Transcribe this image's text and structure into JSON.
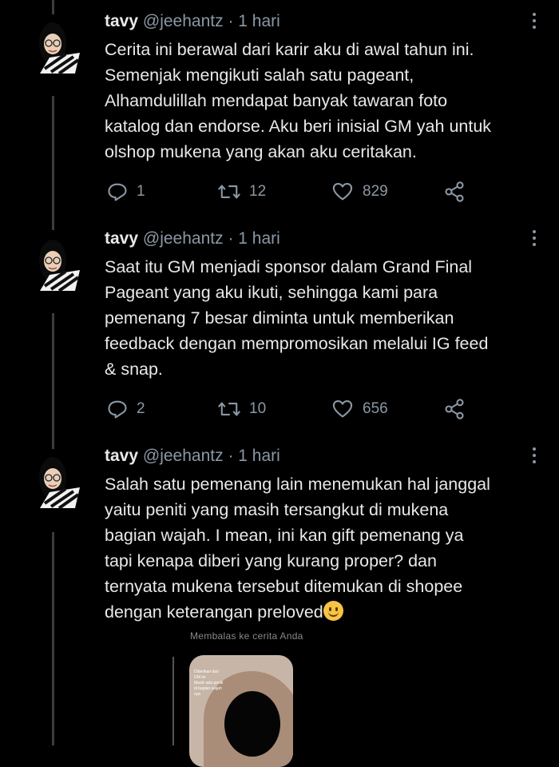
{
  "tweets": [
    {
      "name": "tavy",
      "handle": "@jeehantz",
      "separator": "·",
      "time": "1 hari",
      "lines": [
        "Cerita ini berawal dari karir aku di awal tahun ini.",
        "Semenjak mengikuti salah satu pageant,",
        "Alhamdulillah mendapat banyak tawaran foto",
        "katalog dan endorse. Aku beri inisial GM yah untuk",
        "olshop mukena yang akan aku ceritakan."
      ],
      "replies": "1",
      "retweets": "12",
      "likes": "829"
    },
    {
      "name": "tavy",
      "handle": "@jeehantz",
      "separator": "·",
      "time": "1 hari",
      "lines": [
        "Saat itu GM menjadi sponsor dalam Grand Final",
        "Pageant yang aku ikuti, sehingga kami para",
        "pemenang 7 besar diminta untuk memberikan",
        "feedback dengan mempromosikan melalui IG feed",
        "& snap."
      ],
      "replies": "2",
      "retweets": "10",
      "likes": "656"
    },
    {
      "name": "tavy",
      "handle": "@jeehantz",
      "separator": "·",
      "time": "1 hari",
      "lines": [
        "Salah satu pemenang lain menemukan hal janggal",
        "yaitu peniti yang masih tersangkut di mukena",
        "bagian wajah. I mean, ini kan gift pemenang ya",
        "tapi kenapa diberi yang kurang proper? dan",
        "ternyata mukena tersebut ditemukan di shopee",
        "dengan keterangan preloved"
      ],
      "emoji": "slightly-smiling-face"
    }
  ],
  "story": {
    "caption": "Membalas ke cerita Anda",
    "text_lines": [
      "Diberikan dari",
      "GM ini",
      "Masih ada peniti",
      "di bagian wajah",
      "nya"
    ]
  },
  "icons": {
    "reply": "reply-icon",
    "retweet": "retweet-icon",
    "like": "heart-icon",
    "share": "share-icon",
    "more": "more-vertical-icon"
  },
  "colors": {
    "background": "#000000",
    "text": "#e7e9ea",
    "muted": "#8b98a5",
    "thread_line": "#3a3d40"
  }
}
